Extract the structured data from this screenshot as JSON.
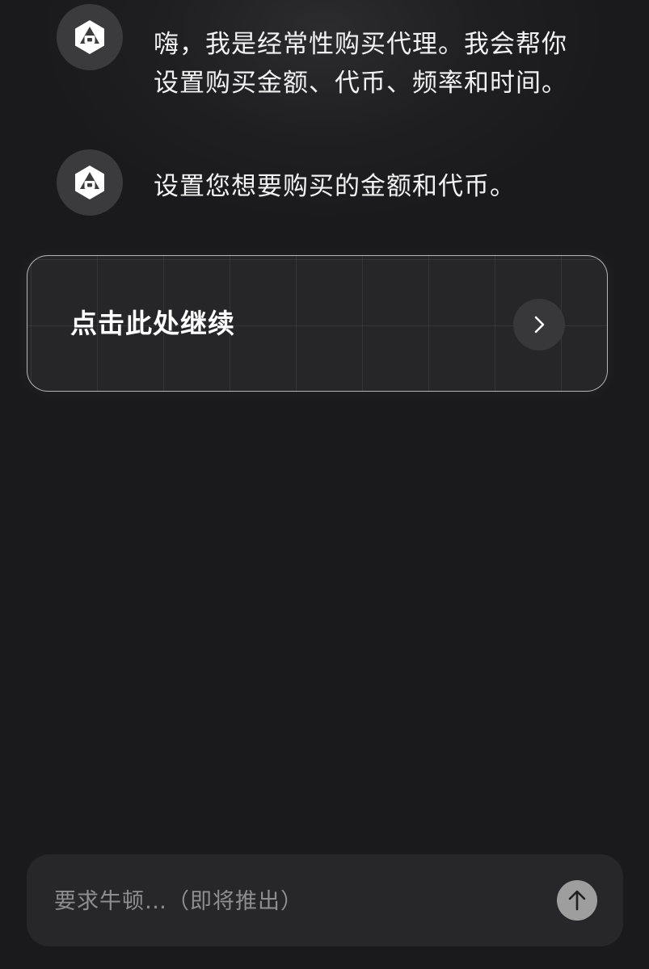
{
  "messages": [
    {
      "text": "嗨，我是经常性购买代理。我会帮你设置购买金额、代币、频率和时间。"
    },
    {
      "text": "设置您想要购买的金额和代币。"
    }
  ],
  "action_card": {
    "label": "点击此处继续",
    "icon": "chevron-right-icon"
  },
  "composer": {
    "placeholder": "要求牛顿…（即将推出）",
    "value": "",
    "send_icon": "arrow-up-icon"
  },
  "avatar_icon": "newton-logo-icon",
  "colors": {
    "background": "#1a1a1c",
    "card_border": "#e6e6e6",
    "send_button": "#9e9e9e",
    "avatar_bg": "#3b3b3d"
  }
}
